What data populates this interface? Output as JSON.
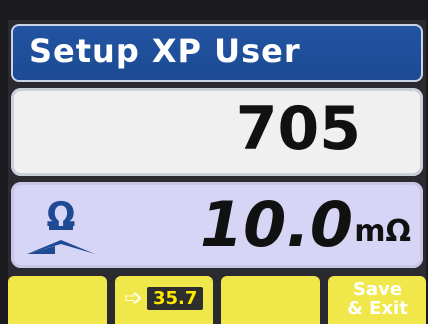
{
  "title": "Setup XP User",
  "value": "705",
  "reading": {
    "value": "10.0",
    "unit": "mΩ",
    "icon": "ohm-meter-icon"
  },
  "softkeys": [
    {
      "label": ""
    },
    {
      "icon": "arrow-right-icon",
      "display": "35.7"
    },
    {
      "label": ""
    },
    {
      "line1": "Save",
      "line2": "& Exit"
    }
  ],
  "colors": {
    "title_bg": "#2254a3",
    "reading_bg": "#d7d5f6",
    "softkey_bg": "#f0e84a"
  }
}
